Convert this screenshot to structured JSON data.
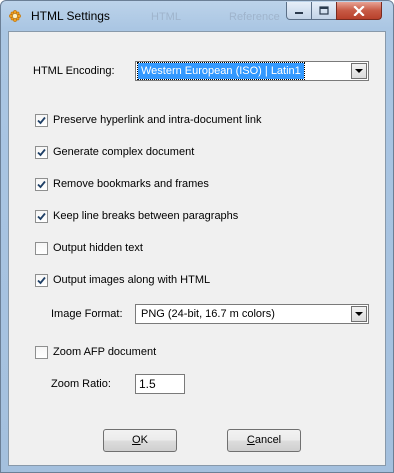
{
  "window": {
    "title": "HTML Settings",
    "ghost_title_fragments": [
      "HTML",
      "Reference"
    ]
  },
  "title_buttons": {
    "minimize_icon": "minimize-icon",
    "maximize_icon": "maximize-icon",
    "close_icon": "close-icon"
  },
  "encoding": {
    "label": "HTML Encoding:",
    "value": "Western European (ISO) | Latin1"
  },
  "options": [
    {
      "label": "Preserve hyperlink and intra-document link",
      "checked": true
    },
    {
      "label": "Generate complex document",
      "checked": true
    },
    {
      "label": "Remove bookmarks and frames",
      "checked": true
    },
    {
      "label": "Keep line breaks between paragraphs",
      "checked": true
    },
    {
      "label": "Output hidden text",
      "checked": false
    },
    {
      "label": "Output images along with HTML",
      "checked": true
    }
  ],
  "image_format": {
    "label": "Image Format:",
    "value": "PNG (24-bit, 16.7 m colors)"
  },
  "zoom_afp": {
    "label": "Zoom AFP document",
    "checked": false
  },
  "zoom_ratio": {
    "label": "Zoom Ratio:",
    "value": "1.5"
  },
  "buttons": {
    "ok_mnemonic": "O",
    "ok_rest": "K",
    "cancel_mnemonic": "C",
    "cancel_rest": "ancel"
  },
  "colors": {
    "accent_selection": "#3399ff",
    "close_button": "#c75a45",
    "frame": "#aac6e3"
  }
}
